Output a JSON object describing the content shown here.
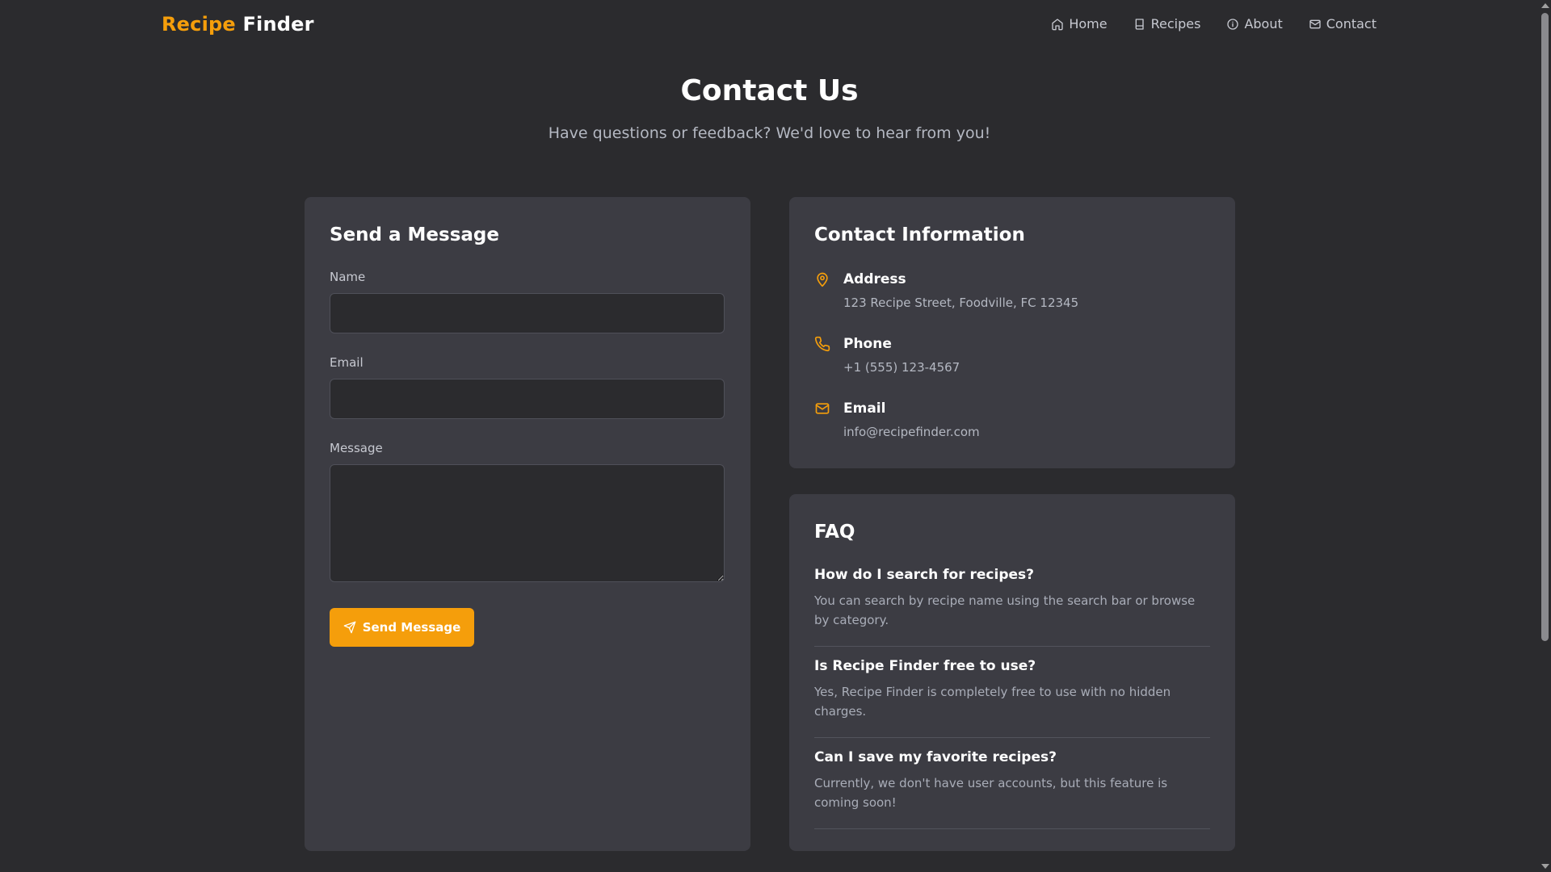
{
  "brand": {
    "accent": "Recipe",
    "main": "Finder",
    "accent_color": "#f59e0b"
  },
  "nav": {
    "items": [
      {
        "label": "Home",
        "icon": "home-icon"
      },
      {
        "label": "Recipes",
        "icon": "book-icon"
      },
      {
        "label": "About",
        "icon": "info-icon"
      },
      {
        "label": "Contact",
        "icon": "mail-icon"
      }
    ]
  },
  "hero": {
    "title": "Contact Us",
    "subtitle": "Have questions or feedback? We'd love to hear from you!"
  },
  "form": {
    "title": "Send a Message",
    "name_label": "Name",
    "name_value": "",
    "email_label": "Email",
    "email_value": "",
    "message_label": "Message",
    "message_value": "",
    "submit_label": "Send Message",
    "submit_icon": "send-icon"
  },
  "contact_info": {
    "title": "Contact Information",
    "items": [
      {
        "heading": "Address",
        "value": "123 Recipe Street, Foodville, FC 12345",
        "icon": "map-pin-icon"
      },
      {
        "heading": "Phone",
        "value": "+1 (555) 123-4567",
        "icon": "phone-icon"
      },
      {
        "heading": "Email",
        "value": "info@recipefinder.com",
        "icon": "mail-icon"
      }
    ]
  },
  "faq": {
    "title": "FAQ",
    "items": [
      {
        "question": "How do I search for recipes?",
        "answer": "You can search by recipe name using the search bar or browse by category."
      },
      {
        "question": "Is Recipe Finder free to use?",
        "answer": "Yes, Recipe Finder is completely free to use with no hidden charges."
      },
      {
        "question": "Can I save my favorite recipes?",
        "answer": "Currently, we don't have user accounts, but this feature is coming soon!"
      }
    ]
  },
  "colors": {
    "background": "#2b2b2e",
    "card": "#3c3c43",
    "accent": "#f59e0b"
  }
}
